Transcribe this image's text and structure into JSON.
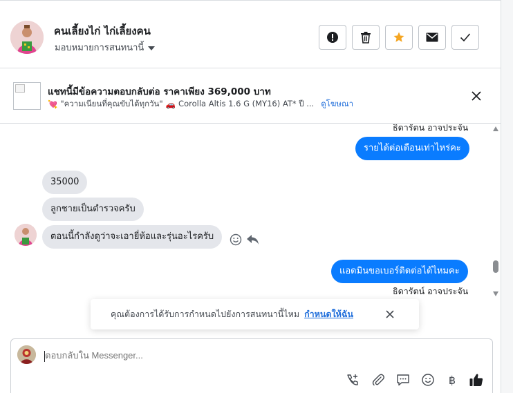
{
  "header": {
    "contact_name": "คนเลี้ยงไก่ ไก่เลี้ยงคน",
    "assign_label": "มอบหมายการสนทนานี้",
    "actions": [
      {
        "icon": "alert-icon"
      },
      {
        "icon": "trash-icon"
      },
      {
        "icon": "star-icon"
      },
      {
        "icon": "envelope-icon"
      },
      {
        "icon": "check-icon"
      }
    ],
    "star_color": "#f5a623"
  },
  "ad": {
    "title": "แชทนี้มีข้อความตอบกลับต่อ ราคาเพียง 369,000 บาท",
    "heart_emoji": "💘",
    "quote": "\"ความเนียนที่คุณขับได้ทุกวัน\"",
    "car_emoji": "🚗",
    "car_text": "Corolla Altis 1.6 G (MY16) AT* ปี ...",
    "link": "ดูโฆษณา"
  },
  "messages": {
    "sender_top": "ธิดารัตน อาจประจัน",
    "out_1": "รายได้ต่อเดือนเท่าไหร่คะ",
    "in_1": "35000",
    "in_2": "ลูกชายเป็นตำรวจครับ",
    "in_3": "ตอนนี้กำลังดูว่าจะเอายี่ห้อและรุ่นอะไรครับ",
    "out_2": "แอดมินขอเบอร์ติดต่อได้ไหมคะ",
    "sender_bottom": "ธิดารัตน์ อาจประจัน",
    "out_color": "#0a7cff",
    "in_color": "#e4e6eb"
  },
  "toast": {
    "text": "คุณต้องการได้รับการกำหนดไปยังการสนทนานี้ไหม",
    "link": "กำหนดให้ฉัน"
  },
  "composer": {
    "placeholder": "ตอบกลับใน Messenger...",
    "currency_symbol": "฿",
    "tools": [
      "call-add-icon",
      "attachment-icon",
      "saved-replies-icon",
      "emoji-icon",
      "currency-icon",
      "thumbs-up-icon"
    ]
  }
}
